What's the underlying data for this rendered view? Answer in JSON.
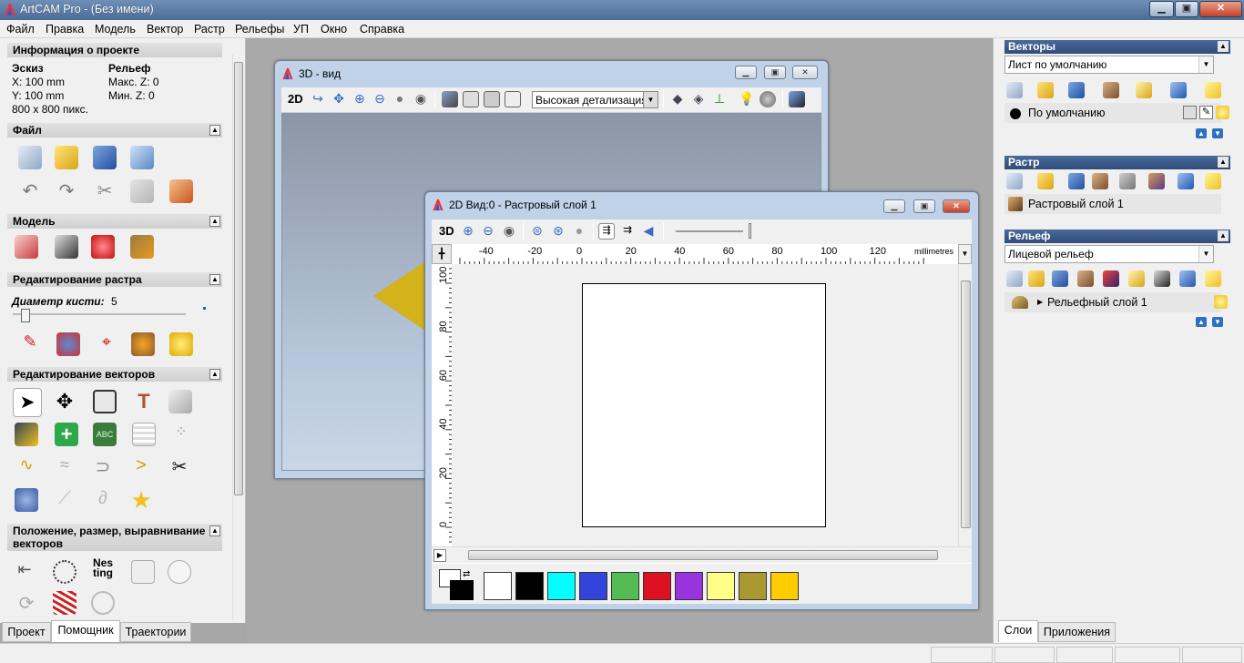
{
  "app": {
    "title": "ArtCAM Pro - (Без имени)"
  },
  "menu": [
    "Файл",
    "Правка",
    "Модель",
    "Вектор",
    "Растр",
    "Рельефы",
    "УП",
    "Окно",
    "Справка"
  ],
  "left": {
    "project_info": {
      "header": "Информация о проекте",
      "sketch_label": "Эскиз",
      "relief_label": "Рельеф",
      "x": "X: 100 mm",
      "y": "Y: 100 mm",
      "pixels": "800 x 800 пикс.",
      "max_z": "Макс. Z: 0",
      "min_z": "Мин. Z: 0"
    },
    "file_header": "Файл",
    "model_header": "Модель",
    "raster_edit_header": "Редактирование растра",
    "brush_label": "Диаметр кисти:",
    "brush_value": "5",
    "brush_fraction": 0.05,
    "vector_edit_header": "Редактирование векторов",
    "position_header_1": "Положение, размер, выравнивание",
    "position_header_2": "векторов",
    "nesting_icon_text_1": "Nes",
    "nesting_icon_text_2": "ting"
  },
  "tabs_left": [
    "Проект",
    "Помощник",
    "Траектории"
  ],
  "tabs_right": [
    "Слои",
    "Приложения"
  ],
  "win3d": {
    "title": "3D - вид",
    "mode": "2D",
    "detail": "Высокая детализация"
  },
  "win2d": {
    "title": "2D Вид:0 - Растровый слой 1",
    "mode": "3D",
    "units": "millimetres",
    "h_ticks": [
      "-40",
      "-20",
      "0",
      "20",
      "40",
      "60",
      "80",
      "100",
      "120"
    ],
    "v_ticks": [
      "100",
      "80",
      "60",
      "40",
      "20",
      "0"
    ]
  },
  "palette": [
    "#ffffff",
    "#000000",
    "#00ffff",
    "#3344dd",
    "#55bb55",
    "#dd1122",
    "#9933dd",
    "#ffff88",
    "#aa9933",
    "#ffcc00"
  ],
  "right": {
    "vectors_header": "Векторы",
    "vectors_sheet": "Лист по умолчанию",
    "vectors_layer": "По умолчанию",
    "raster_header": "Растр",
    "raster_layer": "Растровый слой 1",
    "relief_header": "Рельеф",
    "relief_combo": "Лицевой рельеф",
    "relief_layer": "Рельефный слой 1"
  }
}
